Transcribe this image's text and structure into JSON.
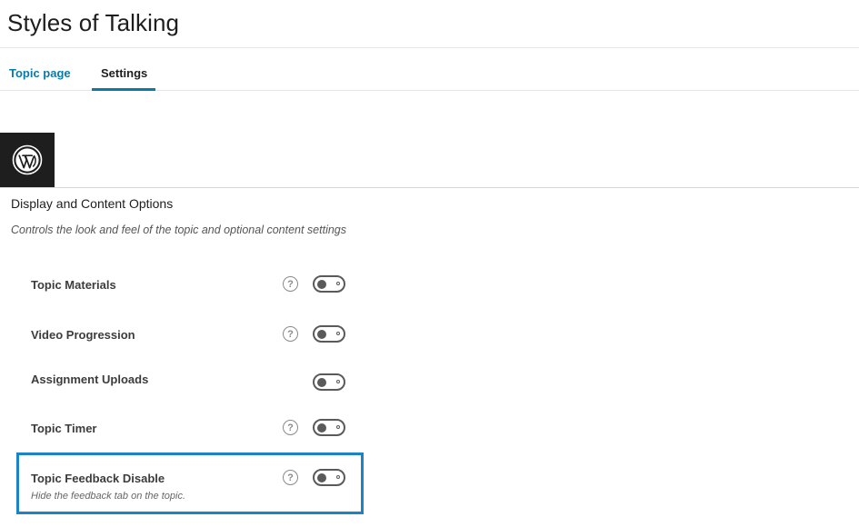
{
  "page": {
    "title": "Styles of Talking"
  },
  "tabs": [
    {
      "label": "Topic page",
      "active": false
    },
    {
      "label": "Settings",
      "active": true
    }
  ],
  "colors": {
    "accent": "#0a7aa7",
    "highlight_border": "#1b84c6",
    "logo_bg": "#1e1e1e"
  },
  "logo": {
    "icon": "wordpress-logo-icon"
  },
  "section": {
    "title": "Display and Content Options",
    "description": "Controls the look and feel of the topic and optional content settings"
  },
  "settings": [
    {
      "label": "Topic Materials",
      "has_help": true,
      "enabled": false,
      "help_symbol": "?"
    },
    {
      "label": "Video Progression",
      "has_help": true,
      "enabled": false,
      "help_symbol": "?"
    },
    {
      "label": "Assignment Uploads",
      "has_help": false,
      "enabled": false
    },
    {
      "label": "Topic Timer",
      "has_help": true,
      "enabled": false,
      "help_symbol": "?"
    },
    {
      "label": "Topic Feedback Disable",
      "has_help": true,
      "enabled": false,
      "help_symbol": "?",
      "description": "Hide the feedback tab on the topic.",
      "highlighted": true
    }
  ]
}
